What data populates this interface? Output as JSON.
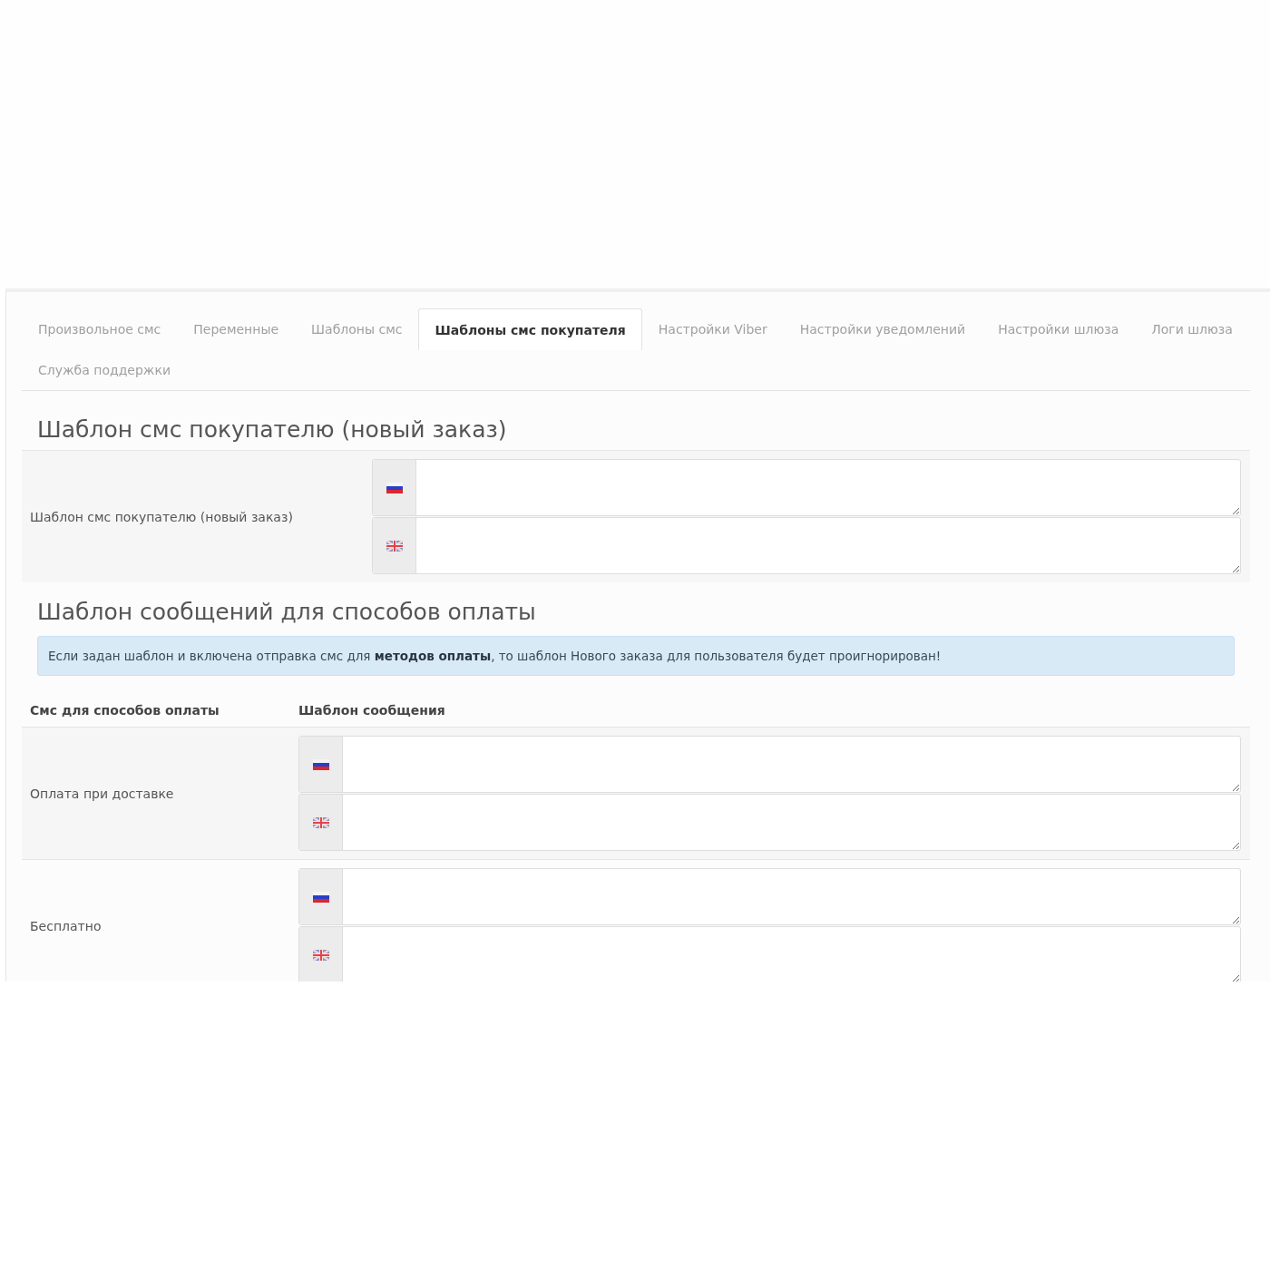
{
  "tabs": [
    {
      "label": "Произвольное смс",
      "selected": false
    },
    {
      "label": "Переменные",
      "selected": false
    },
    {
      "label": "Шаблоны смс",
      "selected": false
    },
    {
      "label": "Шаблоны смс покупателя",
      "selected": true
    },
    {
      "label": "Настройки Viber",
      "selected": false
    },
    {
      "label": "Настройки уведомлений",
      "selected": false
    },
    {
      "label": "Настройки шлюза",
      "selected": false
    },
    {
      "label": "Логи шлюза",
      "selected": false
    },
    {
      "label": "Служба поддержки",
      "selected": false
    }
  ],
  "new_order_section": {
    "heading": "Шаблон смс покупателю (новый заказ)",
    "label": "Шаблон смс покупателю (новый заказ)",
    "fields": [
      {
        "kind": "ru"
      },
      {
        "kind": "en"
      }
    ]
  },
  "payment_section": {
    "heading": "Шаблон сообщений для способов оплаты",
    "alert": "Если задан шаблон и включена отправка смс для **методов оплаты**, то шаблон Нового заказа для пользователя будет проигнорирован!",
    "columns": [
      "Смс для способов оплаты",
      "Шаблон сообщения"
    ],
    "rows": [
      {
        "label": "Оплата при доставке",
        "fields": [
          {
            "kind": "ru"
          },
          {
            "kind": "en"
          }
        ]
      },
      {
        "label": "Бесплатно",
        "fields": [
          {
            "kind": "ru"
          },
          {
            "kind": "en"
          }
        ]
      }
    ]
  }
}
